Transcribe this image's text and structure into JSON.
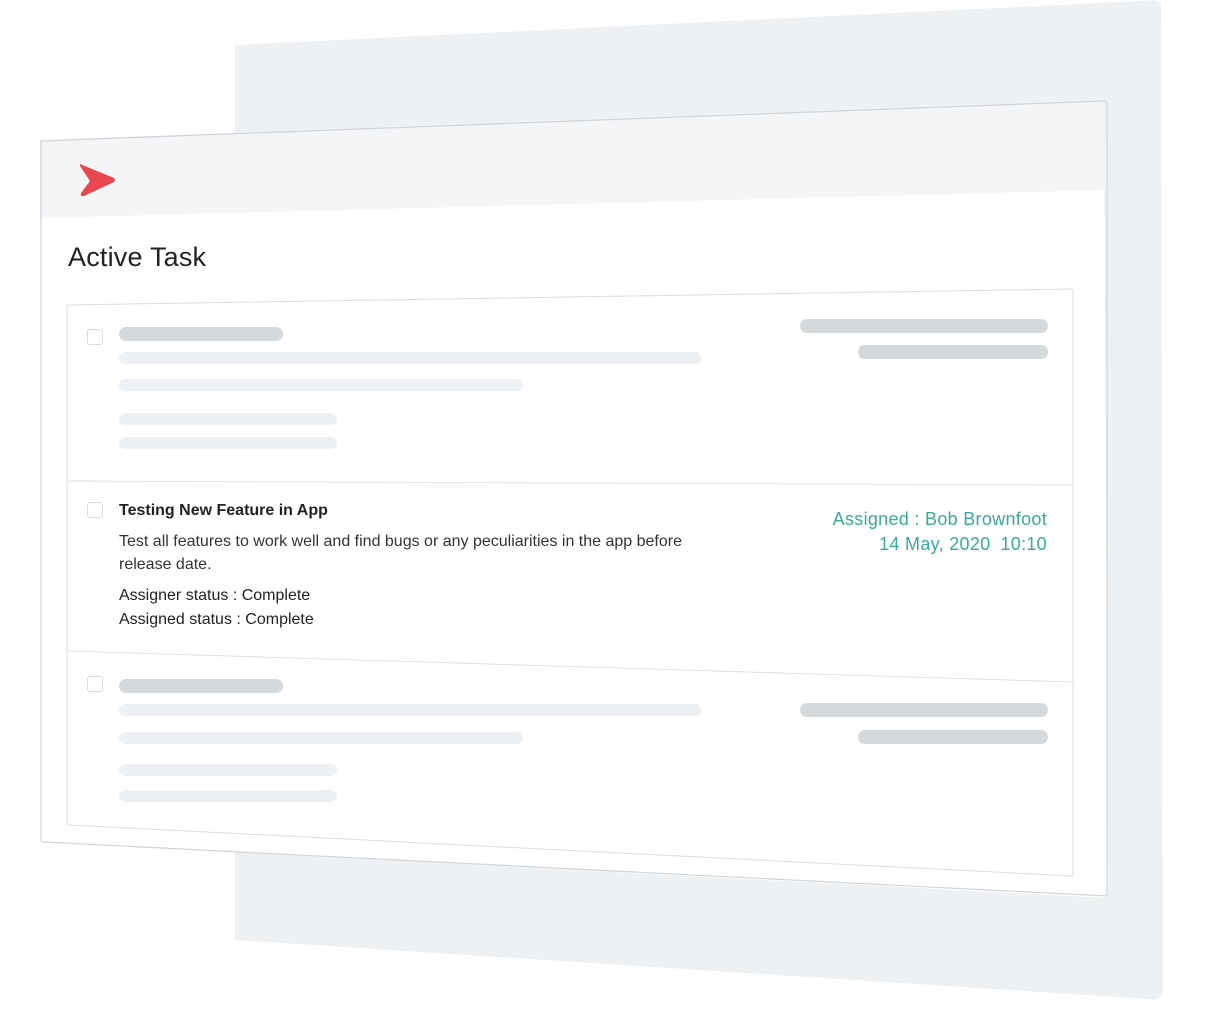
{
  "page": {
    "title": "Active Task"
  },
  "colors": {
    "accent": "#3aaa9b",
    "logo": "#e8474f",
    "skeleton_dark": "#d5d9dc",
    "skeleton_light": "#edf1f5",
    "panel_bg": "#eef1f4"
  },
  "logo": {
    "icon": "play-chevron-logo-icon"
  },
  "tasks": [
    {
      "state": "loading-placeholder"
    },
    {
      "title": "Testing New Feature in App",
      "description": "Test all features to work well and find bugs or any peculiarities in the app before release date.",
      "assigner_status": "Assigner status : Complete",
      "assigned_status": "Assigned status : Complete",
      "assigned": "Assigned : Bob Brownfoot",
      "date": "14 May, 2020",
      "time": "10:10"
    },
    {
      "state": "loading-placeholder"
    }
  ]
}
